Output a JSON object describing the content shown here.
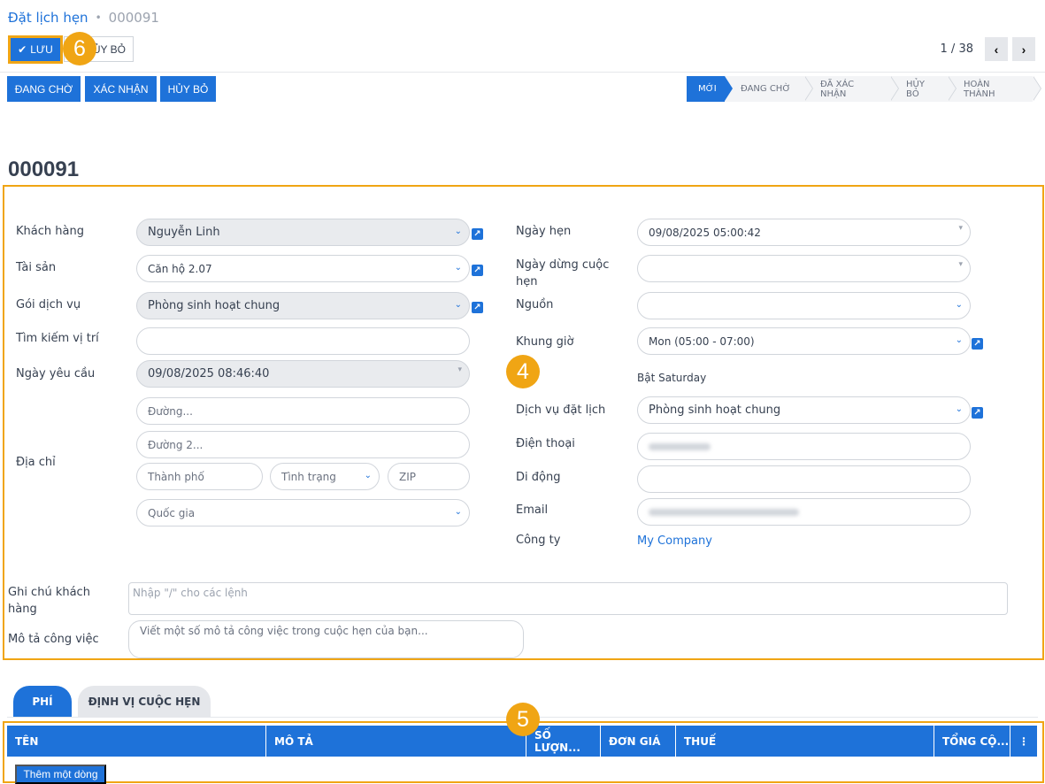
{
  "breadcrumb": {
    "parent": "Đặt lịch hẹn",
    "separator": "•",
    "current": "000091"
  },
  "toolbar": {
    "save_icon": "check-icon",
    "save_label": "LƯU",
    "cancel_label": "HỦY BỎ"
  },
  "annotations": {
    "save_badge": "6",
    "form_badge": "4",
    "table_badge": "5"
  },
  "pager": {
    "text": "1 / 38",
    "prev": "‹",
    "next": "›"
  },
  "actions": [
    "ĐANG CHỜ",
    "XÁC NHẬN",
    "HỦY BỎ"
  ],
  "statusbar": [
    "MỚI",
    "ĐANG CHỜ",
    "ĐÃ XÁC NHẬN",
    "HỦY BỎ",
    "HOÀN THÀNH"
  ],
  "record": {
    "title": "000091"
  },
  "form": {
    "left": {
      "customer": {
        "label": "Khách hàng",
        "value": "Nguyễn Linh"
      },
      "asset": {
        "label": "Tài sản",
        "value": "Căn hộ 2.07"
      },
      "package": {
        "label": "Gói dịch vụ",
        "value": "Phòng sinh hoạt chung"
      },
      "search_location": {
        "label": "Tìm kiếm vị trí",
        "value": ""
      },
      "request_date": {
        "label": "Ngày yêu cầu",
        "value": "09/08/2025 08:46:40"
      },
      "address": {
        "label": "Địa chỉ",
        "street": "Đường...",
        "street2": "Đường 2...",
        "city": "Thành phố",
        "state": "Tình trạng",
        "zip": "ZIP",
        "country": "Quốc gia"
      }
    },
    "right": {
      "appointment_date": {
        "label": "Ngày hẹn",
        "value": "09/08/2025 05:00:42"
      },
      "stop_date": {
        "label": "Ngày dừng cuộc hẹn",
        "value": ""
      },
      "source": {
        "label": "Nguồn",
        "value": ""
      },
      "time_slot": {
        "label": "Khung giờ",
        "value": "Mon (05:00 - 07:00)"
      },
      "slot_note": "Bật Saturday",
      "booking_service": {
        "label": "Dịch vụ đặt lịch",
        "value": "Phòng sinh hoạt chung"
      },
      "phone": {
        "label": "Điện thoại"
      },
      "mobile": {
        "label": "Di động",
        "value": ""
      },
      "email": {
        "label": "Email"
      },
      "company": {
        "label": "Công ty",
        "value": "My Company"
      }
    },
    "customer_note": {
      "label": "Ghi chú khách hàng",
      "placeholder": "Nhập \"/\" cho các lệnh"
    },
    "job_description": {
      "label": "Mô tả công việc",
      "placeholder": "Viết một số mô tả công việc trong cuộc hẹn của bạn..."
    }
  },
  "tabs": [
    "PHÍ",
    "ĐỊNH VỊ CUỘC HẸN"
  ],
  "table": {
    "columns": [
      "TÊN",
      "MÔ TẢ",
      "SỐ LƯỢN...",
      "ĐƠN GIÁ",
      "THUẾ",
      "TỔNG CỘ..."
    ],
    "add_line": "Thêm một dòng"
  },
  "colors": {
    "primary": "#1e72d9",
    "highlight": "#f0a514"
  }
}
